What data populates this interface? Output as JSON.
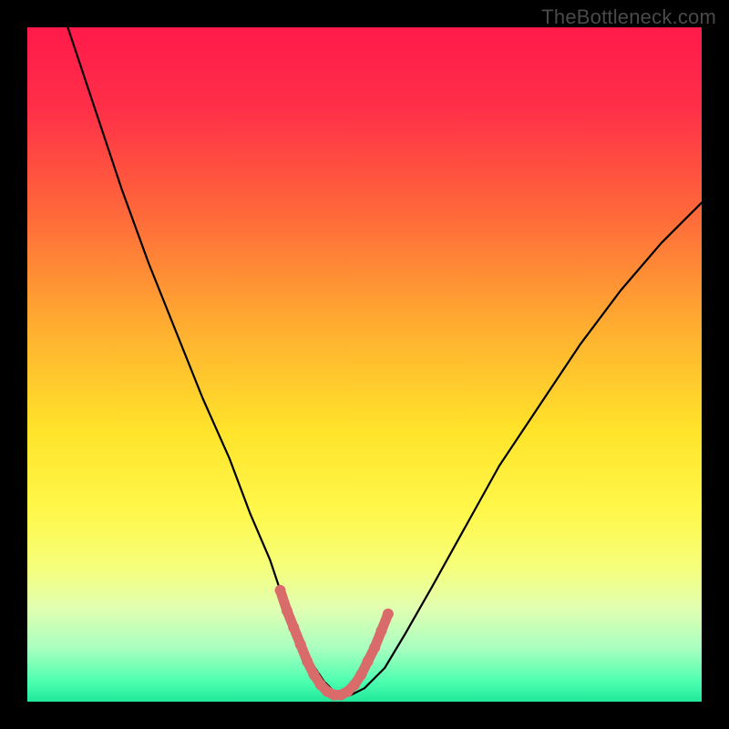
{
  "watermark": "TheBottleneck.com",
  "chart_data": {
    "type": "line",
    "title": "",
    "xlabel": "",
    "ylabel": "",
    "xlim": [
      0,
      100
    ],
    "ylim": [
      0,
      100
    ],
    "gradient_stops": [
      {
        "pct": 0,
        "color": "#ff1a4a"
      },
      {
        "pct": 12,
        "color": "#ff2f48"
      },
      {
        "pct": 28,
        "color": "#ff6a3a"
      },
      {
        "pct": 45,
        "color": "#ffb030"
      },
      {
        "pct": 60,
        "color": "#ffe42a"
      },
      {
        "pct": 72,
        "color": "#fff84c"
      },
      {
        "pct": 80,
        "color": "#f6ff7a"
      },
      {
        "pct": 86,
        "color": "#e2ffb0"
      },
      {
        "pct": 92,
        "color": "#aaffc0"
      },
      {
        "pct": 97,
        "color": "#4dffb0"
      },
      {
        "pct": 100,
        "color": "#20e89a"
      }
    ],
    "series": [
      {
        "name": "bottleneck-curve",
        "x": [
          6,
          10,
          14,
          18,
          22,
          26,
          30,
          33,
          36,
          38,
          40,
          42,
          44,
          46,
          48,
          50,
          53,
          56,
          60,
          65,
          70,
          76,
          82,
          88,
          94,
          100
        ],
        "y": [
          100,
          88,
          76,
          65,
          55,
          45,
          36,
          28,
          21,
          15,
          10,
          6,
          3,
          1,
          1,
          2,
          5,
          10,
          17,
          26,
          35,
          44,
          53,
          61,
          68,
          74
        ]
      }
    ],
    "highlight": {
      "name": "optimal-range",
      "color": "#d96b6b",
      "x": [
        37.5,
        38.5,
        39.5,
        40.5,
        41.5,
        42.5,
        43.5,
        44.5,
        45.5,
        46.5,
        47.5,
        48.5,
        49.5,
        50.5,
        51.5,
        52.5,
        53.5
      ],
      "y": [
        16.5,
        13.5,
        11,
        8.5,
        6,
        4,
        2.5,
        1.5,
        1,
        1,
        1.5,
        2.5,
        4,
        6,
        8,
        10.5,
        13
      ]
    }
  }
}
